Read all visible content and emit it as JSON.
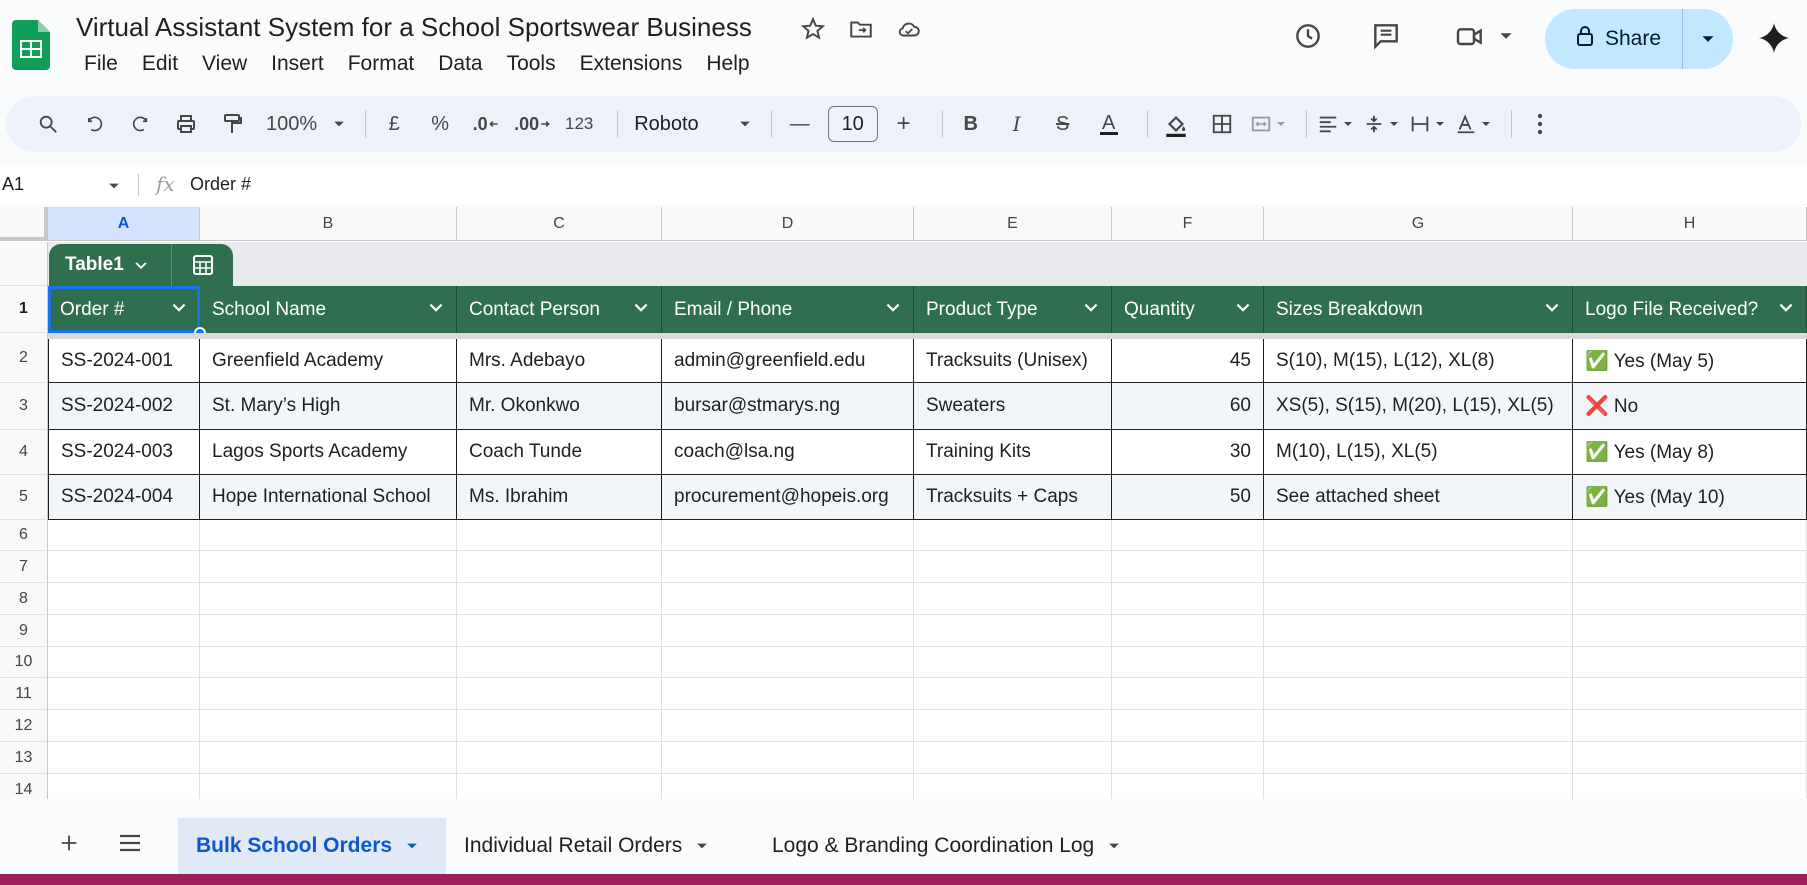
{
  "doc_title": "Virtual Assistant System for a School Sportswear Business",
  "menu": [
    "File",
    "Edit",
    "View",
    "Insert",
    "Format",
    "Data",
    "Tools",
    "Extensions",
    "Help"
  ],
  "share_label": "Share",
  "toolbar": {
    "zoom": "100%",
    "currency": "£",
    "percent": "%",
    "dec_decrease": ".0",
    "dec_increase": ".00",
    "number_format": "123",
    "font": "Roboto",
    "font_size": "10"
  },
  "formula_bar": {
    "cell_ref": "A1",
    "fx": "fx",
    "value": "Order #"
  },
  "columns": [
    "A",
    "B",
    "C",
    "D",
    "E",
    "F",
    "G",
    "H"
  ],
  "rows": [
    "1",
    "2",
    "3",
    "4",
    "5",
    "6",
    "7",
    "8",
    "9",
    "10",
    "11",
    "12",
    "13",
    "14"
  ],
  "table_name": "Table1",
  "table": {
    "headers": [
      "Order #",
      "School Name",
      "Contact Person",
      "Email / Phone",
      "Product Type",
      "Quantity",
      "Sizes Breakdown",
      "Logo File Received?"
    ],
    "rows": [
      [
        "SS-2024-001",
        "Greenfield Academy",
        "Mrs. Adebayo",
        "admin@greenfield.edu",
        "Tracksuits (Unisex)",
        "45",
        "S(10), M(15), L(12), XL(8)",
        "✅ Yes (May 5)"
      ],
      [
        "SS-2024-002",
        "St. Mary’s High",
        "Mr. Okonkwo",
        "bursar@stmarys.ng",
        "Sweaters",
        "60",
        "XS(5), S(15), M(20), L(15), XL(5)",
        "❌ No"
      ],
      [
        "SS-2024-003",
        "Lagos Sports Academy",
        "Coach Tunde",
        "coach@lsa.ng",
        "Training Kits",
        "30",
        "M(10), L(15), XL(5)",
        "✅ Yes (May 8)"
      ],
      [
        "SS-2024-004",
        "Hope International School",
        "Ms. Ibrahim",
        "procurement@hopeis.org",
        "Tracksuits + Caps",
        "50",
        "See attached sheet",
        "✅ Yes (May 10)"
      ]
    ]
  },
  "sheets": [
    "Bulk School Orders",
    "Individual Retail Orders",
    "Logo & Branding Coordination Log"
  ],
  "colors": {
    "header_green": "#2f6f4e",
    "share_bg": "#c2e7ff",
    "active_tab": "#0b57d0"
  }
}
